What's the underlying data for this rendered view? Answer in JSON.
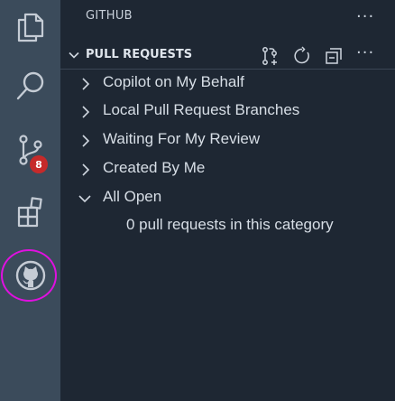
{
  "activity_bar": {
    "scm_badge": "8"
  },
  "sidebar": {
    "title": "GITHUB",
    "more_actions": "···",
    "section": {
      "title": "PULL REQUESTS",
      "more_actions": "···"
    },
    "tree": [
      {
        "label": "Copilot on My Behalf",
        "expanded": false
      },
      {
        "label": "Local Pull Request Branches",
        "expanded": false
      },
      {
        "label": "Waiting For My Review",
        "expanded": false
      },
      {
        "label": "Created By Me",
        "expanded": false
      },
      {
        "label": "All Open",
        "expanded": true
      }
    ],
    "empty_message": "0 pull requests in this category"
  },
  "colors": {
    "activity_bar_bg": "#3b4b5b",
    "sidebar_bg": "#1e2733",
    "badge": "#c62a2a",
    "highlight_ring": "#e010e0"
  }
}
